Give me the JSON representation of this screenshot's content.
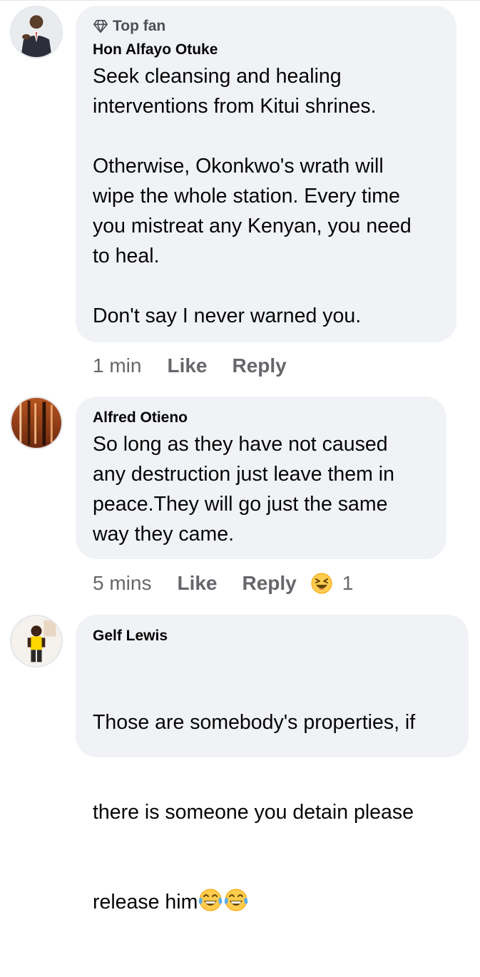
{
  "comments": [
    {
      "badge": "Top fan",
      "author": "Hon Alfayo Otuke",
      "text": "Seek cleansing and healing\ninterventions from Kitui shrines.\n\nOtherwise, Okonkwo's wrath will\nwipe the whole station. Every time\nyou mistreat any Kenyan, you need\nto heal.\n\nDon't say I never warned you.",
      "time": "1 min",
      "like": "Like",
      "reply": "Reply"
    },
    {
      "author": "Alfred Otieno",
      "text": "So long as they have not caused\nany destruction just leave them in\npeace.They will go just the same\nway they came.",
      "time": "5 mins",
      "like": "Like",
      "reply": "Reply",
      "reaction_count": "1",
      "reaction_icon": "laughing-emoji-icon"
    },
    {
      "author": "Gelf Lewis",
      "text_line1": "Those are somebody's properties, if",
      "text_line2": "there is someone you detain please",
      "text_line3": "release him",
      "trailing_emojis": [
        "tears-of-joy-emoji-icon",
        "tears-of-joy-emoji-icon"
      ]
    }
  ],
  "colors": {
    "bubble": "#f0f2f5",
    "secondary_text": "#65676b",
    "primary_text": "#050505",
    "emoji_yellow": "#ffcc4d"
  }
}
